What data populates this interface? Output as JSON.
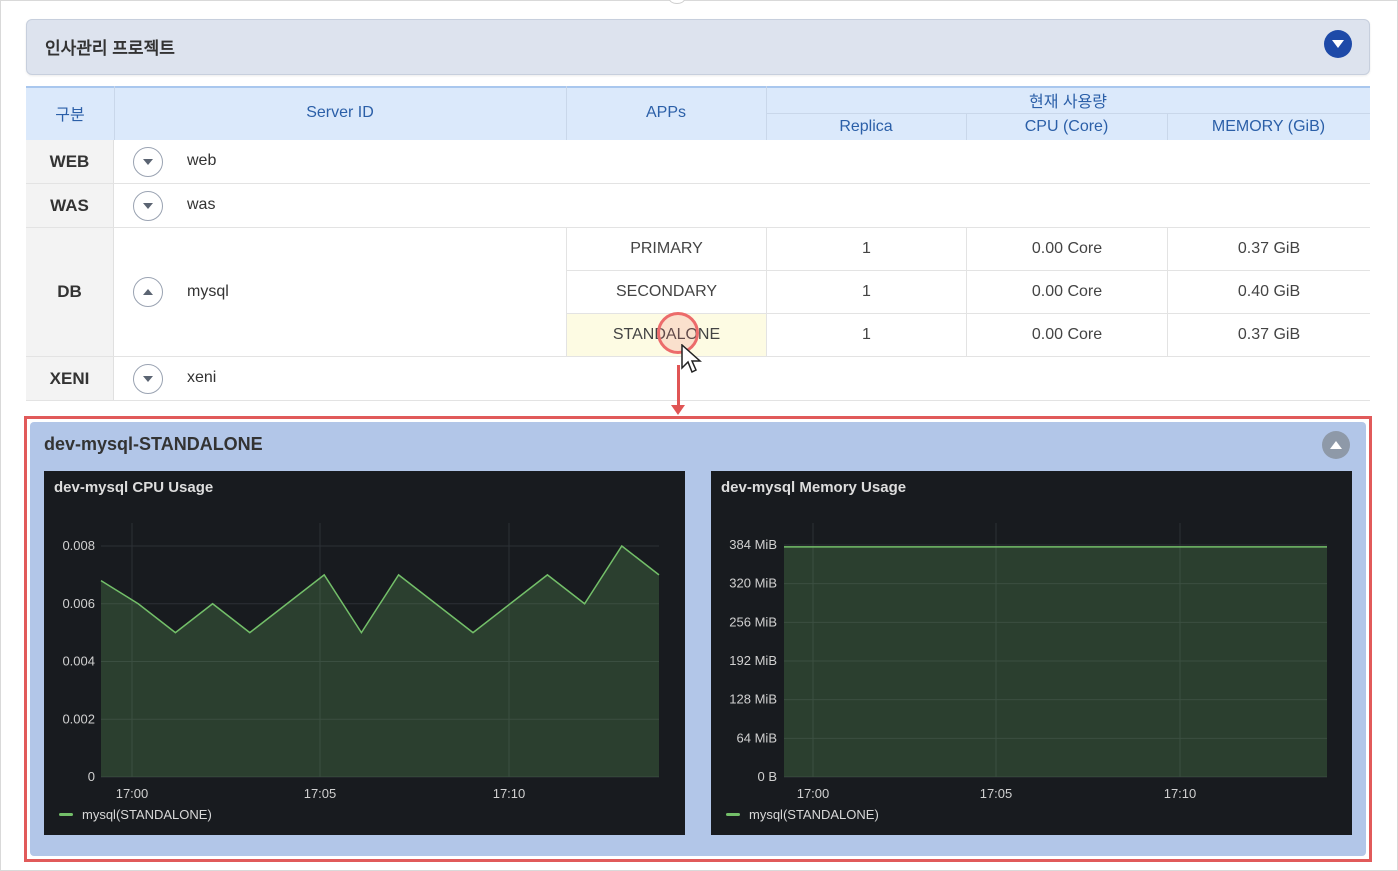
{
  "project": {
    "title": "인사관리 프로젝트"
  },
  "table": {
    "headers": {
      "group": "구분",
      "server_id": "Server ID",
      "apps": "APPs",
      "current_usage": "현재 사용량",
      "replica": "Replica",
      "cpu": "CPU (Core)",
      "memory": "MEMORY (GiB)"
    },
    "rows": [
      {
        "group": "WEB",
        "server": "web"
      },
      {
        "group": "WAS",
        "server": "was"
      },
      {
        "group": "DB",
        "server": "mysql",
        "apps": [
          {
            "name": "PRIMARY",
            "replica": "1",
            "cpu": "0.00 Core",
            "memory": "0.37 GiB"
          },
          {
            "name": "SECONDARY",
            "replica": "1",
            "cpu": "0.00 Core",
            "memory": "0.40 GiB"
          },
          {
            "name": "STANDALONE",
            "replica": "1",
            "cpu": "0.00 Core",
            "memory": "0.37 GiB"
          }
        ]
      },
      {
        "group": "XENI",
        "server": "xeni"
      }
    ]
  },
  "detail": {
    "title": "dev-mysql-STANDALONE",
    "cpu_panel": {
      "title": "dev-mysql CPU Usage",
      "legend": "mysql(STANDALONE)"
    },
    "mem_panel": {
      "title": "dev-mysql Memory Usage",
      "legend": "mysql(STANDALONE)"
    }
  },
  "colors": {
    "accent": "#1e4aa8",
    "series": "#73bf69",
    "highlight": "#e15a5a",
    "panel_bg": "#181b1f"
  },
  "chart_data": [
    {
      "type": "area",
      "title": "dev-mysql CPU Usage",
      "x_ticks": [
        "17:00",
        "17:05",
        "17:10"
      ],
      "y_ticks": [
        "0.008",
        "0.006",
        "0.004",
        "0.002",
        "0"
      ],
      "ylim": [
        0,
        0.008
      ],
      "x": [
        16.97,
        16.99,
        16.98,
        17.01,
        17.02,
        17.04,
        17.05,
        17.06,
        17.07,
        17.08,
        17.09,
        17.1,
        17.11,
        17.12,
        17.13,
        17.14
      ],
      "series": [
        {
          "name": "mysql(STANDALONE)",
          "values": [
            0.0068,
            0.006,
            0.005,
            0.006,
            0.005,
            0.006,
            0.007,
            0.005,
            0.007,
            0.006,
            0.005,
            0.006,
            0.007,
            0.006,
            0.008,
            0.007
          ]
        }
      ],
      "grid": true,
      "legend": "bottom-left"
    },
    {
      "type": "area",
      "title": "dev-mysql Memory Usage",
      "x_ticks": [
        "17:00",
        "17:05",
        "17:10"
      ],
      "y_ticks": [
        "384 MiB",
        "320 MiB",
        "256 MiB",
        "192 MiB",
        "128 MiB",
        "64 MiB",
        "0 B"
      ],
      "ylim": [
        0,
        384
      ],
      "series": [
        {
          "name": "mysql(STANDALONE)",
          "values": [
            381,
            381,
            381,
            381,
            381,
            381,
            381,
            381,
            381,
            381,
            381,
            381,
            381,
            381,
            381,
            381
          ]
        }
      ],
      "grid": true,
      "legend": "bottom-left"
    }
  ]
}
